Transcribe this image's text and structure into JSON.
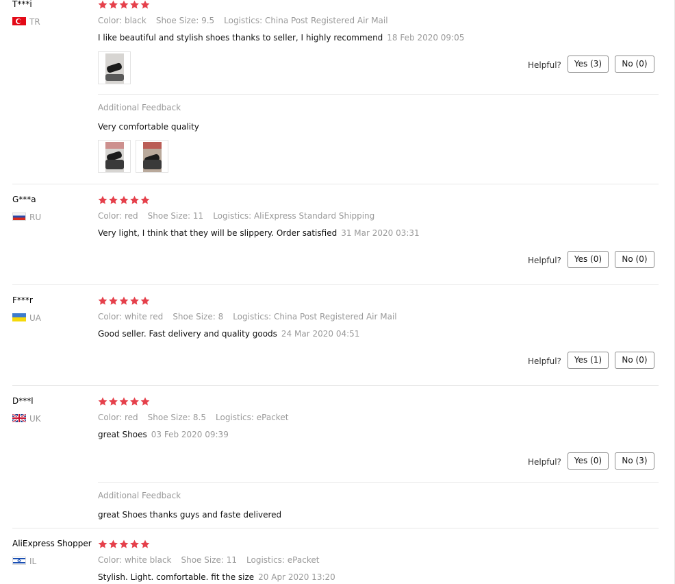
{
  "star_color": "#e5404b",
  "reviews": [
    {
      "user": "T***i",
      "country_code": "TR",
      "flag": "tr-flag-icon",
      "rating": 5,
      "color": "Color: black",
      "size": "Shoe Size: 9.5",
      "logistics": "Logistics: China Post Registered Air Mail",
      "text": "I like beautiful and stylish shoes thanks to seller, I highly recommend",
      "date": "18 Feb 2020 09:05",
      "helpful_label": "Helpful?",
      "yes_label": "Yes (3)",
      "no_label": "No (0)",
      "additional_label": "Additional Feedback",
      "additional_text": "Very comfortable quality"
    },
    {
      "user": "G***a",
      "country_code": "RU",
      "flag": "ru-flag-icon",
      "rating": 5,
      "color": "Color: red",
      "size": "Shoe Size: 11",
      "logistics": "Logistics: AliExpress Standard Shipping",
      "text": "Very light, I think that they will be slippery. Order satisfied",
      "date": "31 Mar 2020 03:31",
      "helpful_label": "Helpful?",
      "yes_label": "Yes (0)",
      "no_label": "No (0)"
    },
    {
      "user": "F***r",
      "country_code": "UA",
      "flag": "ua-flag-icon",
      "rating": 5,
      "color": "Color: white red",
      "size": "Shoe Size: 8",
      "logistics": "Logistics: China Post Registered Air Mail",
      "text": "Good seller. Fast delivery and quality goods",
      "date": "24 Mar 2020 04:51",
      "helpful_label": "Helpful?",
      "yes_label": "Yes (1)",
      "no_label": "No (0)"
    },
    {
      "user": "D***l",
      "country_code": "UK",
      "flag": "uk-flag-icon",
      "rating": 5,
      "color": "Color: red",
      "size": "Shoe Size: 8.5",
      "logistics": "Logistics: ePacket",
      "text": "great Shoes",
      "date": "03 Feb 2020 09:39",
      "helpful_label": "Helpful?",
      "yes_label": "Yes (0)",
      "no_label": "No (3)",
      "additional_label": "Additional Feedback",
      "additional_text": "great Shoes thanks guys and faste delivered"
    },
    {
      "user": "AliExpress Shopper",
      "country_code": "IL",
      "flag": "il-flag-icon",
      "rating": 5,
      "color": "Color: white black",
      "size": "Shoe Size: 11",
      "logistics": "Logistics: ePacket",
      "text": "Stylish. Light. comfortable. fit the size",
      "date": "20 Apr 2020 13:20"
    }
  ]
}
